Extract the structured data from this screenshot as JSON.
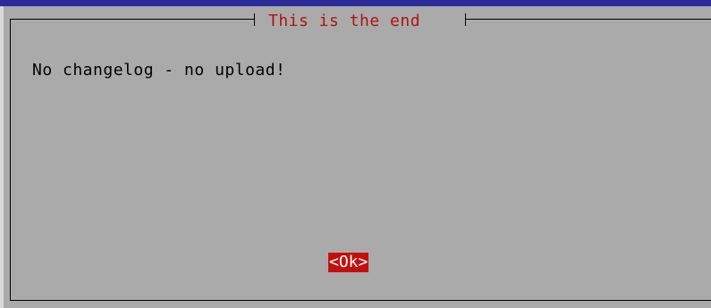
{
  "dialog": {
    "title": "This is the end",
    "message": "No changelog - no upload!",
    "ok_label": "<Ok>"
  },
  "colors": {
    "background": "#2c2c9a",
    "dialog": "#aaaaaa",
    "title_text": "#b0140f",
    "button_focus": "#c40f0f"
  }
}
